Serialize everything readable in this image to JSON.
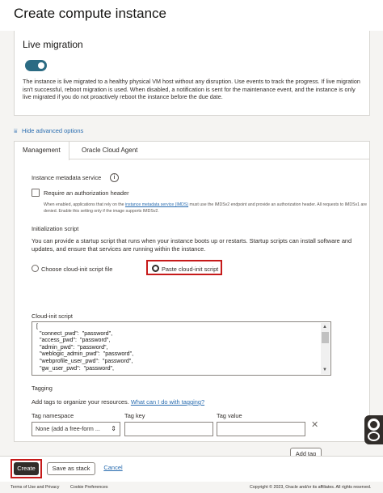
{
  "header": {
    "title": "Create compute instance"
  },
  "live_migration": {
    "heading": "Live migration",
    "toggle_on": true,
    "description": "The instance is live migrated to a healthy physical VM host without any disruption. Use events to track the progress. If live migration isn't successful, reboot migration is used. When disabled, a notification is sent for the maintenance event, and the instance is only live migrated if you do not proactively reboot the instance before the due date."
  },
  "advanced": {
    "link_label": "Hide advanced options",
    "icon": "sliders-icon"
  },
  "tabs": [
    {
      "label": "Management",
      "active": true
    },
    {
      "label": "Oracle Cloud Agent",
      "active": false
    }
  ],
  "management": {
    "imds_heading": "Instance metadata service",
    "require_auth_label": "Require an authorization header",
    "require_auth_checked": false,
    "note_prefix": "When enabled, applications that rely on the",
    "note_link": "instance metadata service (IMDS)",
    "note_suffix": "must use the IMDSv2 endpoint and provide an authorization header. All requests to IMDSv1 are denied. Enable this setting only if the image supports IMDSv2.",
    "init_heading": "Initialization script",
    "init_desc": "You can provide a startup script that runs when your instance boots up or restarts. Startup scripts can install software and updates, and ensure that services are running within the instance.",
    "radio_choose_label": "Choose cloud-init script file",
    "radio_paste_label": "Paste cloud-init script",
    "selected_option": "paste",
    "script_label": "Cloud-init script",
    "script_lines": [
      "[",
      "  \"connect_pwd\":  \"password\",",
      "  \"access_pwd\":  \"password\",",
      "  \"admin_pwd\":  \"password\",",
      "  \"weblogic_admin_pwd\":  \"password\",",
      "  \"webprofile_user_pwd\":  \"password\",",
      "  \"gw_user_pwd\":  \"password\","
    ],
    "tagging_heading": "Tagging",
    "tagging_desc": "Add tags to organize your resources.",
    "tagging_help_link": "What can I do with tagging?",
    "tag_namespace_label": "Tag namespace",
    "tag_key_label": "Tag key",
    "tag_value_label": "Tag value",
    "tag_namespace_value": "None (add a free-form ...",
    "tag_key_value": "",
    "tag_value_value": "",
    "remove_icon": "close-icon",
    "add_tag_label": "Add tag"
  },
  "footer": {
    "create_label": "Create",
    "save_stack_label": "Save as stack",
    "cancel_label": "Cancel"
  },
  "page_footer": {
    "terms": "Terms of Use and Privacy",
    "cookies": "Cookie Preferences",
    "copyright": "Copyright © 2023, Oracle and/or its affiliates. All rights reserved."
  },
  "colors": {
    "accent": "#2b6b83",
    "link": "#2a6db0",
    "highlight": "#c61a1a",
    "primary_button": "#312d2a"
  }
}
